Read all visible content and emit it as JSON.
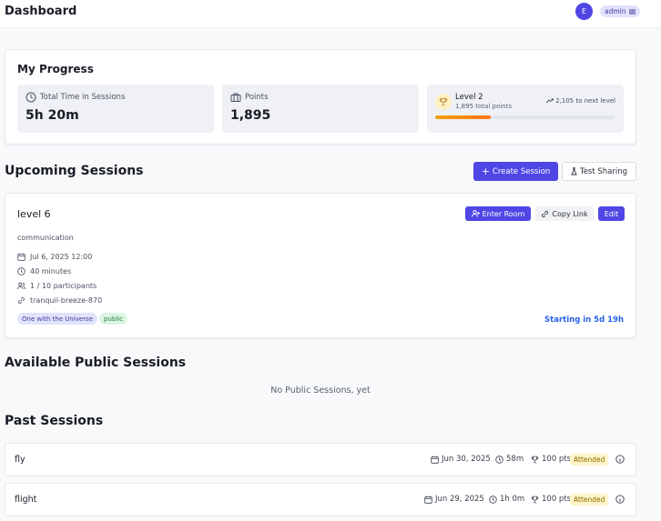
{
  "header": {
    "title": "Dashboard",
    "avatar_initial": "E",
    "role_badge": "admin",
    "role_badge_icon": "menu-icon"
  },
  "progress": {
    "title": "My Progress",
    "total_time": {
      "label": "Total Time in Sessions",
      "value": "5h 20m",
      "icon": "clock-icon"
    },
    "points": {
      "label": "Points",
      "value": "1,895",
      "icon": "briefcase-icon"
    },
    "level": {
      "title": "Level 2",
      "subtitle": "1,895 total points",
      "next": "2,105 to next level",
      "progress_fraction": 0.31,
      "icon": "trophy-icon",
      "bar_colors": [
        "#f59e0b",
        "#f97316"
      ]
    }
  },
  "upcoming": {
    "title": "Upcoming Sessions",
    "create_label": "Create Session",
    "test_label": "Test Sharing",
    "session": {
      "title": "level 6",
      "category": "communication",
      "date": "Jul 6, 2025 12:00",
      "duration": "40 minutes",
      "participants": "1 / 10 participants",
      "room": "tranquil-breeze-870",
      "enter_label": "Enter Room",
      "copy_label": "Copy Link",
      "edit_label": "Edit",
      "tags": [
        "One with the Universe",
        "public"
      ],
      "starting": "Starting in 5d 19h"
    }
  },
  "public": {
    "title": "Available Public Sessions",
    "empty": "No Public Sessions, yet"
  },
  "past": {
    "title": "Past Sessions",
    "sessions": [
      {
        "title": "fly",
        "date": "Jun 30, 2025",
        "duration": "58m",
        "points": "100 pts",
        "status": "Attended"
      },
      {
        "title": "flight",
        "date": "Jun 29, 2025",
        "duration": "1h 0m",
        "points": "100 pts",
        "status": "Attended"
      }
    ]
  },
  "colors": {
    "accent": "#4f46e5",
    "starting_text": "#2563eb",
    "attended_bg": "#fdf5c9"
  }
}
